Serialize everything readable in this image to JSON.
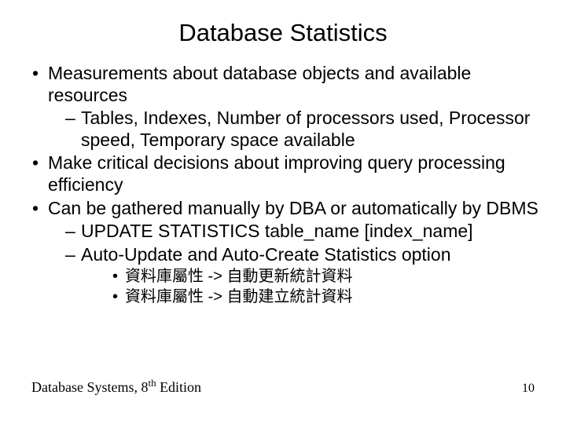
{
  "title": "Database Statistics",
  "bullets": {
    "b1": "Measurements about database objects and available resources",
    "b1s1": "Tables, Indexes, Number of processors used, Processor speed, Temporary space available",
    "b2": "Make critical decisions about improving query processing efficiency",
    "b3": "Can be gathered manually by DBA or automatically by DBMS",
    "b3s1": "UPDATE STATISTICS table_name [index_name]",
    "b3s2": "Auto-Update and Auto-Create Statistics option",
    "b3s2a": "資料庫屬性 -> 自動更新統計資料",
    "b3s2b": "資料庫屬性 -> 自動建立統計資料"
  },
  "footer": {
    "book_before": "Database Systems, 8",
    "book_sup": "th",
    "book_after": " Edition",
    "page": "10"
  }
}
